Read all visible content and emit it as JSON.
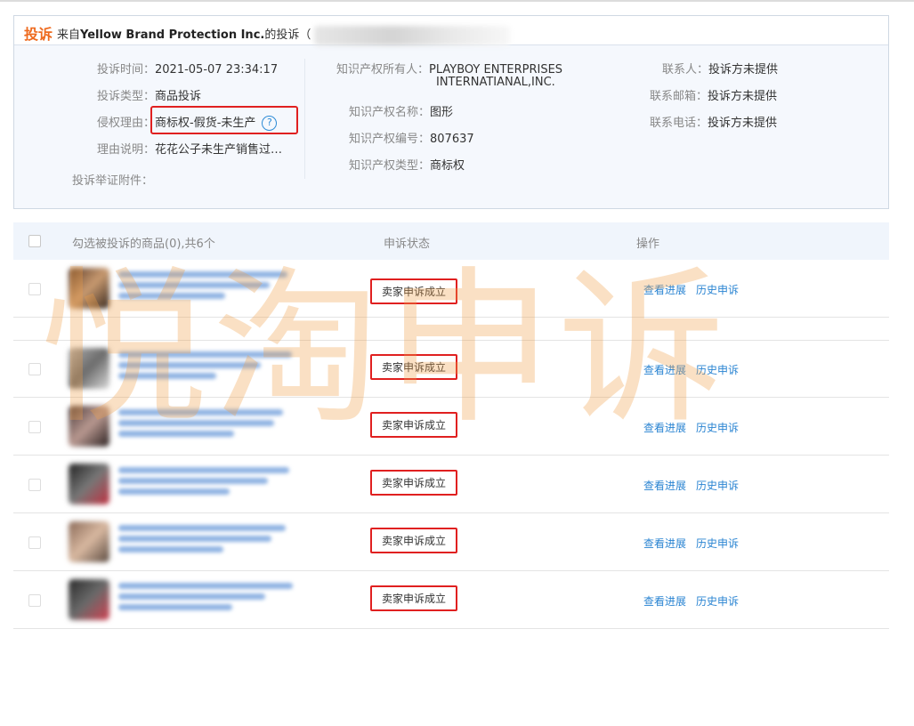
{
  "header": {
    "title": "投诉",
    "from_prefix": "来自",
    "company": "Yellow Brand Protection Inc.",
    "suffix": "的投诉（"
  },
  "details": {
    "complaint_time_label": "投诉时间：",
    "complaint_time": "2021-05-07 23:34:17",
    "complaint_type_label": "投诉类型：",
    "complaint_type": "商品投诉",
    "reason_label": "侵权理由：",
    "reason": "商标权-假货-未生产",
    "explanation_label": "理由说明：",
    "explanation": "花花公子未生产销售过…",
    "attachments_label": "投诉举证附件：",
    "ip_owner_label": "知识产权所有人：",
    "ip_owner_line1": "PLAYBOY ENTERPRISES",
    "ip_owner_line2": "INTERNATIANAL,INC.",
    "ip_name_label": "知识产权名称：",
    "ip_name": "图形",
    "ip_number_label": "知识产权编号：",
    "ip_number": "807637",
    "ip_type_label": "知识产权类型：",
    "ip_type": "商标权",
    "contact_label": "联系人：",
    "contact": "投诉方未提供",
    "email_label": "联系邮箱：",
    "email": "投诉方未提供",
    "phone_label": "联系电话：",
    "phone": "投诉方未提供"
  },
  "table": {
    "col_products": "勾选被投诉的商品(0),共6个",
    "col_status": "申诉状态",
    "col_actions": "操作",
    "rows": [
      {
        "status": "卖家申诉成立",
        "progress_link": "查看进展",
        "history_link": "历史申诉"
      },
      {
        "status": "卖家申诉成立",
        "progress_link": "查看进展",
        "history_link": "历史申诉"
      },
      {
        "status": "卖家申诉成立",
        "progress_link": "查看进展",
        "history_link": "历史申诉"
      },
      {
        "status": "卖家申诉成立",
        "progress_link": "查看进展",
        "history_link": "历史申诉"
      },
      {
        "status": "卖家申诉成立",
        "progress_link": "查看进展",
        "history_link": "历史申诉"
      },
      {
        "status": "卖家申诉成立",
        "progress_link": "查看进展",
        "history_link": "历史申诉"
      }
    ]
  },
  "watermark": "悦淘申诉",
  "icons": {
    "help": "help-circle-icon"
  },
  "colors": {
    "accent": "#ee6a1e",
    "link": "#2a84d2",
    "highlight": "#e02020"
  }
}
